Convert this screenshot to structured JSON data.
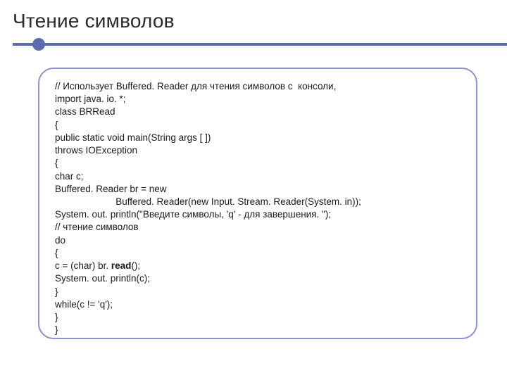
{
  "title": "Чтение символов",
  "code": {
    "l01": "// Использует Buffered. Reader для чтения символов с  консоли,",
    "l02": "import java. io. *;",
    "l03": "class BRRead",
    "l04": "{",
    "l05": "public static void main(String args [ ])",
    "l06": "throws IOException",
    "l07": "{",
    "l08": "char c;",
    "l09": "Buffered. Reader br = new",
    "l10": "                       Buffered. Reader(new Input. Stream. Reader(System. in));",
    "l11": "System. out. println(\"Введите символы, 'q' - для завершения. \");",
    "l12": "// чтение символов",
    "l13": "do",
    "l14": "{",
    "l15a": "c = (char) br. ",
    "l15b": "read",
    "l15c": "();",
    "l16": "System. out. println(c);",
    "l17": "}",
    "l18": "while(c != 'q');",
    "l19": "}",
    "l20": "}"
  }
}
